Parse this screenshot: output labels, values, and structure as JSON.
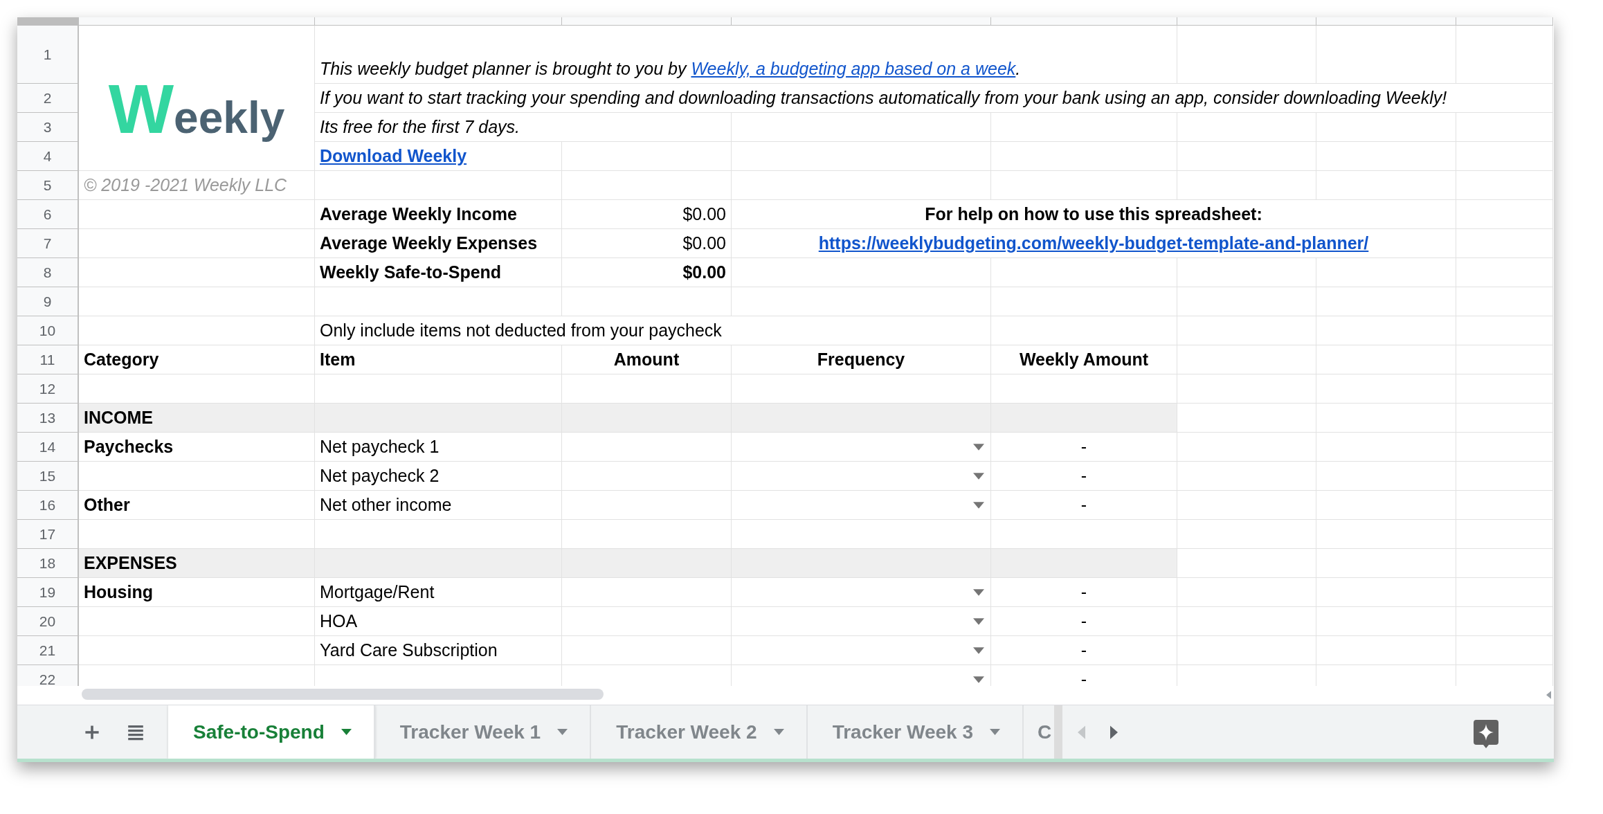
{
  "logo": {
    "text": "Weekly"
  },
  "rows": [
    {
      "number": "1",
      "section": false,
      "cells": [
        {
          "kind": "logo"
        },
        {
          "kind": "rich",
          "parts": [
            {
              "kind": "text",
              "text": "This weekly budget planner is brought to you by "
            },
            {
              "kind": "link",
              "text": "Weekly, a budgeting app based on a week"
            },
            {
              "kind": "text",
              "text": "."
            }
          ]
        }
      ]
    },
    {
      "number": "2",
      "section": false,
      "cells": [
        null,
        {
          "kind": "italic",
          "text": "If you want to start tracking your spending and downloading transactions automatically from your bank using an app, consider downloading Weekly!"
        }
      ]
    },
    {
      "number": "3",
      "section": false,
      "cells": [
        null,
        {
          "kind": "italic",
          "text": "Its free for the first 7 days."
        }
      ]
    },
    {
      "number": "4",
      "section": false,
      "cells": [
        null,
        {
          "kind": "link",
          "text": "Download Weekly"
        }
      ]
    },
    {
      "number": "5",
      "section": false,
      "cells": [
        {
          "kind": "note",
          "text": "© 2019 -2021 Weekly LLC"
        }
      ]
    },
    {
      "number": "6",
      "section": false,
      "cells": [
        null,
        {
          "kind": "bold",
          "text": "Average Weekly Income"
        },
        {
          "kind": "amount",
          "text": "$0.00"
        },
        {
          "kind": "banner",
          "text": "For help on how to use this spreadsheet:"
        }
      ]
    },
    {
      "number": "7",
      "section": false,
      "cells": [
        null,
        {
          "kind": "bold",
          "text": "Average Weekly Expenses"
        },
        {
          "kind": "amount",
          "text": "$0.00"
        },
        {
          "kind": "banner-link",
          "text": "https://weeklybudgeting.com/weekly-budget-template-and-planner/"
        }
      ]
    },
    {
      "number": "8",
      "section": false,
      "cells": [
        null,
        {
          "kind": "bold",
          "text": "Weekly Safe-to-Spend"
        },
        {
          "kind": "total",
          "text": "$0.00"
        }
      ]
    },
    {
      "number": "9",
      "section": false,
      "cells": []
    },
    {
      "number": "10",
      "section": false,
      "cells": [
        null,
        {
          "kind": "text",
          "text": "Only include items not deducted from your paycheck"
        }
      ]
    },
    {
      "number": "11",
      "section": false,
      "cells": [
        {
          "kind": "bold",
          "text": "Category"
        },
        {
          "kind": "bold",
          "text": "Item"
        },
        {
          "kind": "heading-center",
          "text": "Amount"
        },
        {
          "kind": "heading-center",
          "text": "Frequency"
        },
        {
          "kind": "heading-center",
          "text": "Weekly Amount"
        }
      ]
    },
    {
      "number": "12",
      "section": false,
      "cells": []
    },
    {
      "number": "13",
      "section": true,
      "cells": [
        {
          "kind": "bold",
          "text": "INCOME"
        }
      ]
    },
    {
      "number": "14",
      "section": false,
      "cells": [
        {
          "kind": "bold",
          "text": "Paychecks"
        },
        {
          "kind": "text",
          "text": "Net paycheck 1"
        },
        null,
        {
          "kind": "dropdown"
        },
        {
          "kind": "dash",
          "text": "-"
        }
      ]
    },
    {
      "number": "15",
      "section": false,
      "cells": [
        null,
        {
          "kind": "text",
          "text": "Net paycheck 2"
        },
        null,
        {
          "kind": "dropdown"
        },
        {
          "kind": "dash",
          "text": "-"
        }
      ]
    },
    {
      "number": "16",
      "section": false,
      "cells": [
        {
          "kind": "bold",
          "text": "Other"
        },
        {
          "kind": "text",
          "text": "Net other income"
        },
        null,
        {
          "kind": "dropdown"
        },
        {
          "kind": "dash",
          "text": "-"
        }
      ]
    },
    {
      "number": "17",
      "section": false,
      "cells": []
    },
    {
      "number": "18",
      "section": true,
      "cells": [
        {
          "kind": "bold",
          "text": "EXPENSES"
        }
      ]
    },
    {
      "number": "19",
      "section": false,
      "cells": [
        {
          "kind": "bold",
          "text": "Housing"
        },
        {
          "kind": "text",
          "text": "Mortgage/Rent"
        },
        null,
        {
          "kind": "dropdown"
        },
        {
          "kind": "dash",
          "text": "-"
        }
      ]
    },
    {
      "number": "20",
      "section": false,
      "cells": [
        null,
        {
          "kind": "text",
          "text": "HOA"
        },
        null,
        {
          "kind": "dropdown"
        },
        {
          "kind": "dash",
          "text": "-"
        }
      ]
    },
    {
      "number": "21",
      "section": false,
      "cells": [
        null,
        {
          "kind": "text",
          "text": "Yard Care Subscription"
        },
        null,
        {
          "kind": "dropdown"
        },
        {
          "kind": "dash",
          "text": "-"
        }
      ]
    },
    {
      "number": "22",
      "section": false,
      "cells": [
        null,
        null,
        null,
        {
          "kind": "dropdown"
        },
        {
          "kind": "dash",
          "text": "-"
        }
      ]
    }
  ],
  "tabs": [
    {
      "label": "Safe-to-Spend",
      "selected": true
    },
    {
      "label": "Tracker Week 1",
      "selected": false
    },
    {
      "label": "Tracker Week 2",
      "selected": false
    },
    {
      "label": "Tracker Week 3",
      "selected": false
    },
    {
      "label": "C",
      "selected": false
    }
  ]
}
